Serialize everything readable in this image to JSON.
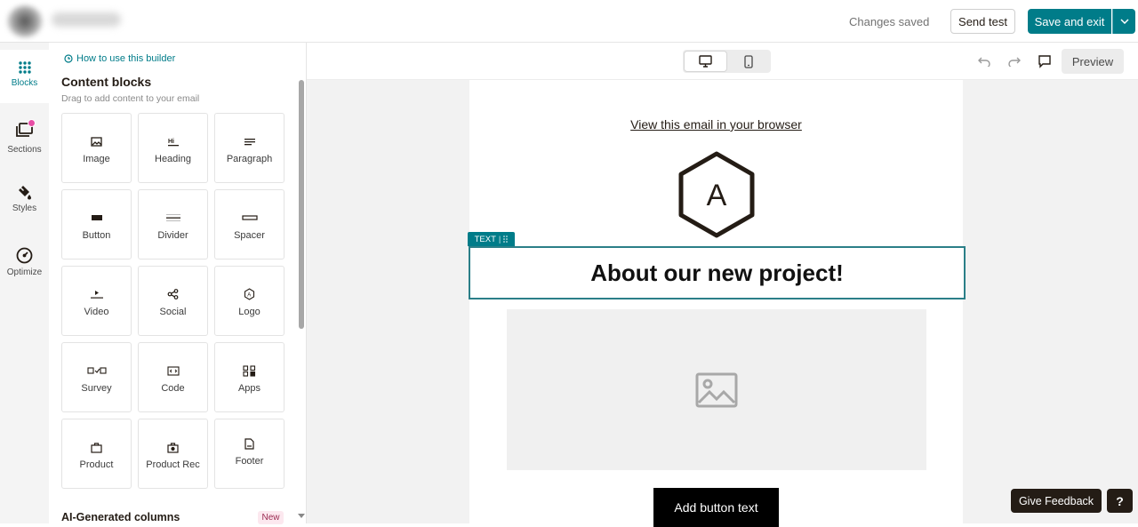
{
  "header": {
    "status": "Changes saved",
    "send_test": "Send test",
    "save_exit": "Save and exit"
  },
  "rail": {
    "items": [
      {
        "label": "Blocks",
        "icon": "grid-dots-icon"
      },
      {
        "label": "Sections",
        "icon": "sections-icon"
      },
      {
        "label": "Styles",
        "icon": "paint-bucket-icon"
      },
      {
        "label": "Optimize",
        "icon": "gauge-icon"
      }
    ]
  },
  "panel": {
    "how_to": "How to use this builder",
    "title": "Content blocks",
    "subtitle": "Drag to add content to your email",
    "blocks": [
      "Image",
      "Heading",
      "Paragraph",
      "Button",
      "Divider",
      "Spacer",
      "Video",
      "Social",
      "Logo",
      "Survey",
      "Code",
      "Apps",
      "Product",
      "Product Rec",
      "Footer"
    ],
    "ai_title": "AI-Generated columns",
    "new_badge": "New"
  },
  "toolbar": {
    "preview": "Preview"
  },
  "email": {
    "view_link": "View this email in your browser",
    "logo_letter": "A",
    "text_tag": "TEXT",
    "heading": "About our new project!",
    "button_text": "Add button text"
  },
  "footer": {
    "feedback": "Give Feedback",
    "help": "?"
  },
  "colors": {
    "accent": "#007c89",
    "dark": "#241c15"
  }
}
